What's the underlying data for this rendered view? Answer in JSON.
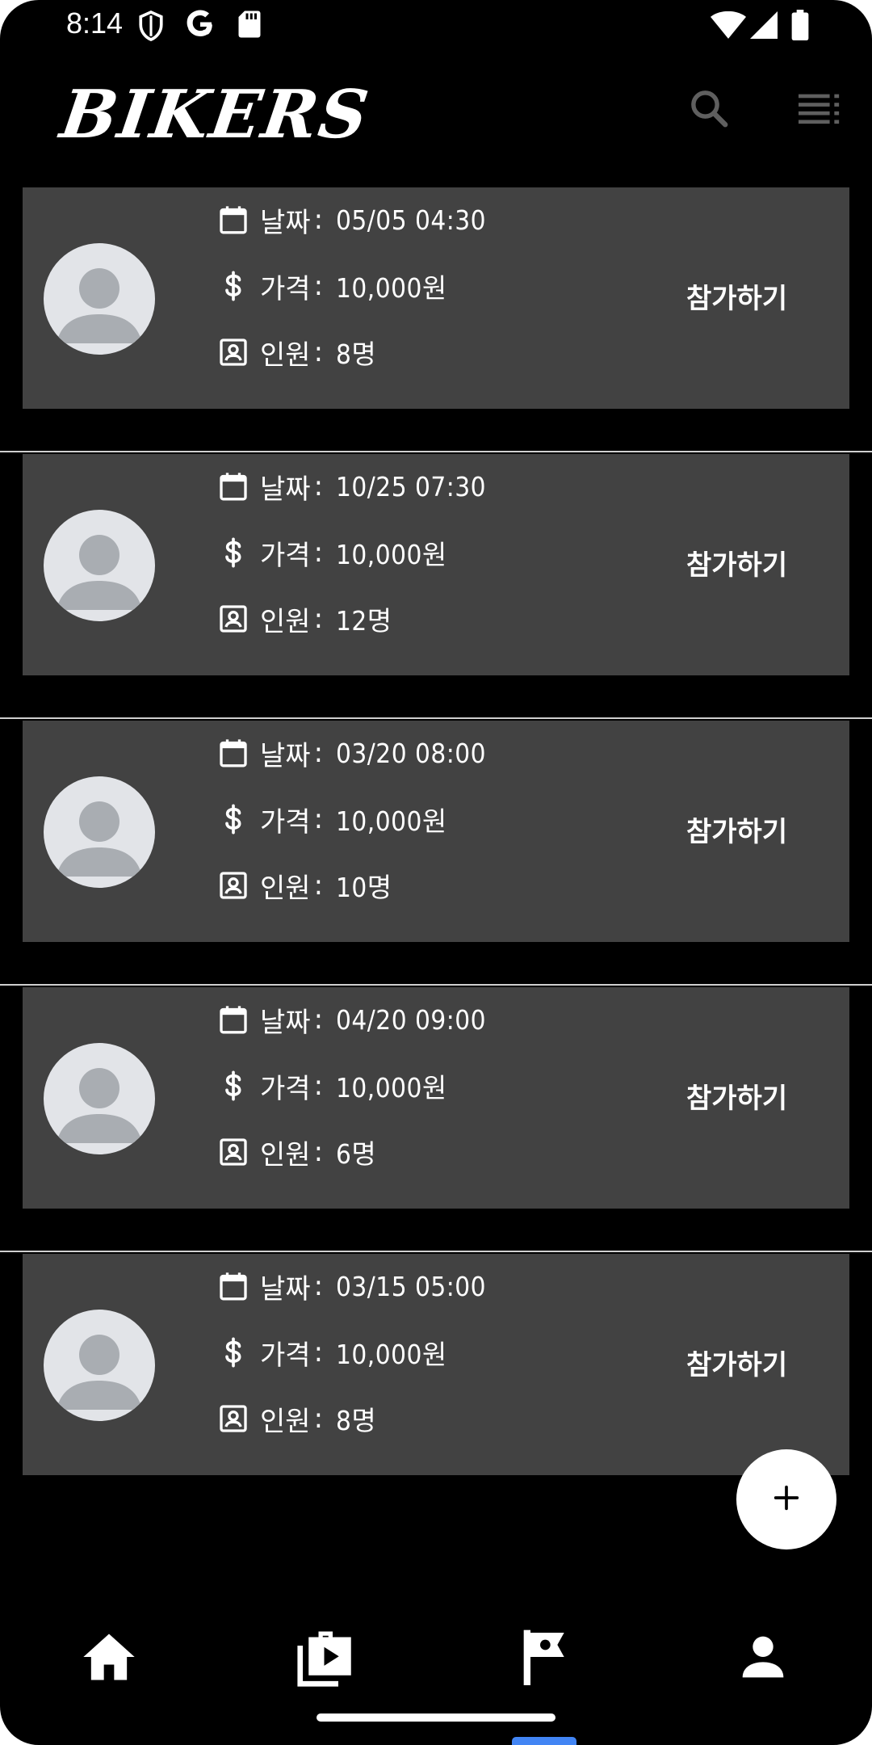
{
  "status_bar": {
    "time": "8:14",
    "icons": [
      "shield-icon",
      "google-icon",
      "sd-card-icon",
      "wifi-icon",
      "signal-icon",
      "battery-icon"
    ]
  },
  "header": {
    "logo_text": "BIKERS",
    "actions": [
      "search-icon",
      "list-menu-icon"
    ]
  },
  "labels": {
    "date": "날짜",
    "price": "가격",
    "people": "인원",
    "separator": ":",
    "join": "참가하기"
  },
  "items": [
    {
      "date": "05/05 04:30",
      "price": "10,000원",
      "people": "8명"
    },
    {
      "date": "10/25 07:30",
      "price": "10,000원",
      "people": "12명"
    },
    {
      "date": "03/20 08:00",
      "price": "10,000원",
      "people": "10명"
    },
    {
      "date": "04/20 09:00",
      "price": "10,000원",
      "people": "6명"
    },
    {
      "date": "03/15 05:00",
      "price": "10,000원",
      "people": "8명"
    }
  ],
  "fab": {
    "icon": "plus-icon"
  },
  "bottom_nav": [
    "home-icon",
    "video-library-icon",
    "flag-icon",
    "person-icon"
  ],
  "colors": {
    "background": "#000000",
    "card": "#424242",
    "avatar_bg": "#e2e4e8",
    "avatar_fg": "#a9adb2",
    "divider": "#cfcfcf",
    "accent_indicator": "#4285f4"
  }
}
